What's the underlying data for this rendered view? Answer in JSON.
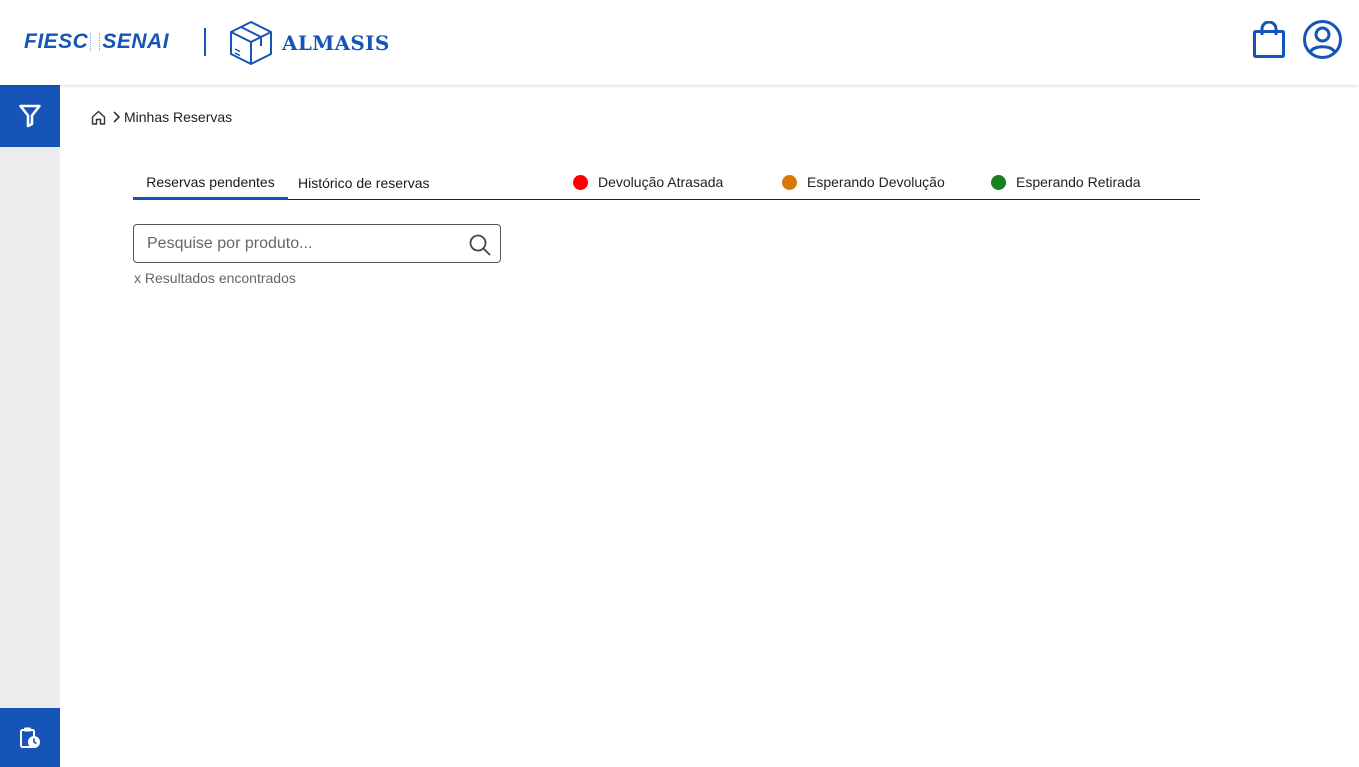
{
  "header": {
    "logo_fiesc": "FIESC",
    "logo_senai": "SENAI",
    "logo_app": "ALMASIS",
    "icons": {
      "cart": "shopping-bag-icon",
      "user": "user-circle-icon",
      "box": "package-box-icon"
    }
  },
  "sidebar": {
    "top_icon": "filter-icon",
    "bottom_icon": "clipboard-clock-icon"
  },
  "breadcrumb": {
    "home_icon": "home-icon",
    "separator_icon": "chevron-right-icon",
    "current": "Minhas Reservas"
  },
  "tabs": [
    {
      "label": "Reservas pendentes",
      "active": true
    },
    {
      "label": "Histórico de reservas",
      "active": false
    }
  ],
  "legend": [
    {
      "label": "Devolução Atrasada",
      "color": "#ff0000"
    },
    {
      "label": "Esperando Devolução",
      "color": "#d97706"
    },
    {
      "label": "Esperando Retirada",
      "color": "#16811e"
    }
  ],
  "search": {
    "placeholder": "Pesquise por produto...",
    "value": "",
    "icon": "search-icon"
  },
  "results_text": "x Resultados encontrados",
  "colors": {
    "brand": "#1654b8",
    "sidebar_bg": "#ececec"
  }
}
